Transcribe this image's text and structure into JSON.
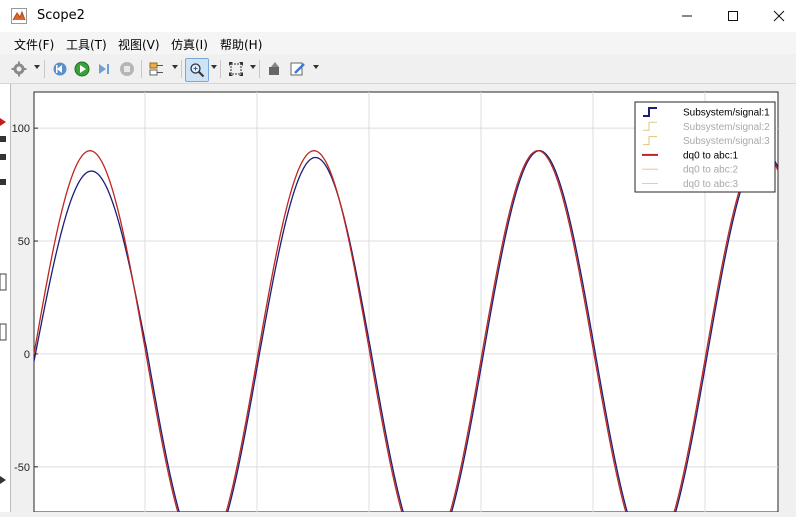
{
  "window": {
    "title": "Scope2",
    "minimize_icon": "minimize-icon",
    "maximize_icon": "maximize-icon",
    "close_icon": "close-icon"
  },
  "menu": {
    "items": [
      "文件(F)",
      "工具(T)",
      "视图(V)",
      "仿真(I)",
      "帮助(H)"
    ]
  },
  "toolbar": {
    "icons": [
      "gear-icon",
      "step-back-icon",
      "run-icon",
      "step-forward-icon",
      "stop-icon",
      "signal-select-icon",
      "zoom-icon",
      "fit-to-view-icon",
      "style-icon",
      "edit-icon"
    ]
  },
  "chart_data": {
    "type": "line",
    "xlabel": "",
    "ylabel": "",
    "title": "",
    "yticks": [
      100,
      50,
      0,
      -50
    ],
    "ylim": [
      -70,
      116
    ],
    "grid": true,
    "legend_position": "top-right",
    "series": [
      {
        "name": "Subsystem/signal:1",
        "color": "#1b1f7a",
        "visible": true,
        "amplitude": 90,
        "first_peak": 81,
        "second_peak": 87
      },
      {
        "name": "Subsystem/signal:2",
        "color": "#a9a9a9",
        "visible": false
      },
      {
        "name": "Subsystem/signal:3",
        "color": "#a9a9a9",
        "visible": false
      },
      {
        "name": "dq0 to abc:1",
        "color": "#c0261f",
        "visible": true,
        "amplitude": 90
      },
      {
        "name": "dq0 to abc:2",
        "color": "#a9a9a9",
        "visible": false
      },
      {
        "name": "dq0 to abc:3",
        "color": "#a9a9a9",
        "visible": false
      }
    ],
    "legend_line_colors": [
      "#1b1f7a",
      "#d9c98a",
      "#e3c27a",
      "#c0261f",
      "#e8c88a",
      "#b9d7e8"
    ]
  }
}
